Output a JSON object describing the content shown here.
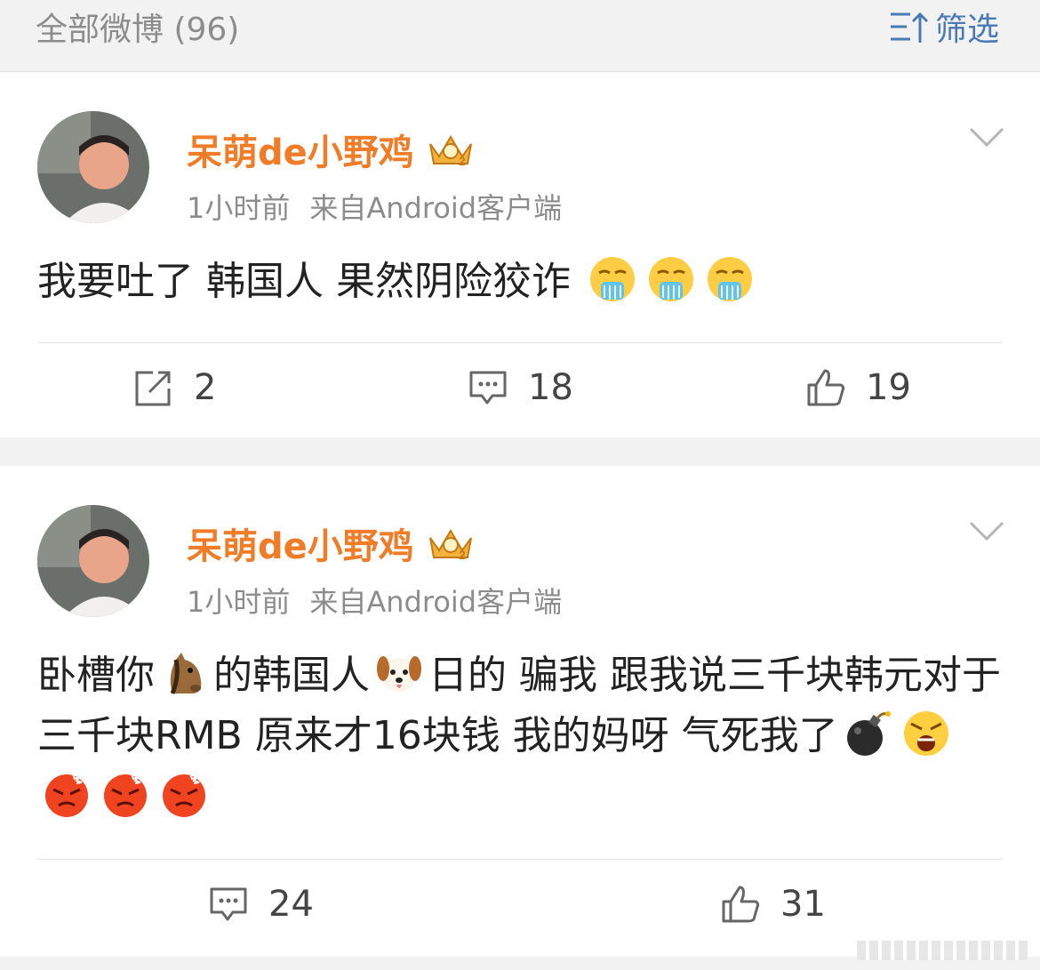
{
  "header": {
    "title": "全部微博 (96)",
    "filter_label": "筛选"
  },
  "posts": [
    {
      "username": "呆萌de小野鸡",
      "time": "1小时前",
      "source": "来自Android客户端",
      "text": "我要吐了 韩国人 果然阴险狡诈",
      "emoji_icons": [
        "vomit-face-icon",
        "vomit-face-icon",
        "vomit-face-icon"
      ],
      "repost_count": "2",
      "comment_count": "18",
      "like_count": "19"
    },
    {
      "username": "呆萌de小野鸡",
      "time": "1小时前",
      "source": "来自Android客户端",
      "text_part1": "卧槽你",
      "text_part2": "的韩国人",
      "text_part3": "日的  骗我 跟我说三千块韩元对于三千块RMB  原来才16块钱   我的妈呀 气死我了",
      "emoji_icons": [
        "horse-face-icon",
        "dog-face-icon",
        "bomb-icon",
        "shouting-face-icon",
        "angry-face-icon",
        "angry-face-icon",
        "angry-face-icon"
      ],
      "comment_count": "24",
      "like_count": "31"
    }
  ]
}
